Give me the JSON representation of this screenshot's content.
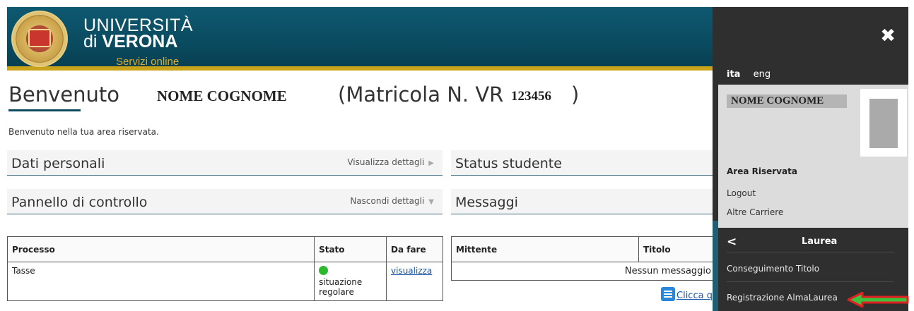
{
  "header": {
    "university_line1": "UNIVERSITÀ",
    "university_line2_prefix": "di",
    "university_line2_name": "VERONA",
    "services_label": "Servizi online"
  },
  "welcome": {
    "title": "Benvenuto",
    "student_name": "NOME COGNOME",
    "matricola_prefix": "(Matricola N. VR",
    "matricola_number": "123456",
    "matricola_close": ")",
    "intro_text": "Benvenuto nella tua area riservata."
  },
  "sections": {
    "personal": {
      "title": "Dati personali",
      "action": "Visualizza dettagli",
      "arrow": "▶"
    },
    "status": {
      "title": "Status studente"
    },
    "control": {
      "title": "Pannello di controllo",
      "action": "Nascondi dettagli",
      "arrow": "▼"
    },
    "messages": {
      "title": "Messaggi"
    }
  },
  "process_table": {
    "headers": [
      "Processo",
      "Stato",
      "Da fare"
    ],
    "rows": [
      {
        "processo": "Tasse",
        "stato_line1": "situazione",
        "stato_line2": "regolare",
        "status_color": "#2db82d",
        "action": "visualizza"
      }
    ]
  },
  "messages_table": {
    "headers": [
      "Mittente",
      "Titolo"
    ],
    "empty_text": "Nessun messaggio",
    "click_link": "Clicca q"
  },
  "panel": {
    "close_icon": "close-icon",
    "lang_active": "ita",
    "lang_other": "eng",
    "user_name": "NOME COGNOME",
    "area_title": "Area Riservata",
    "links": [
      "Logout",
      "Altre Carriere"
    ],
    "submenu_title": "Laurea",
    "menu_items": [
      "Conseguimento Titolo",
      "Registrazione AlmaLaurea"
    ]
  },
  "colors": {
    "header_teal": "#0a4a5f",
    "header_gold": "#c9a41b",
    "panel_dark": "#2f2f2f",
    "status_green": "#2db82d",
    "link_blue": "#1a55a8",
    "annotation_red": "#e02020"
  }
}
